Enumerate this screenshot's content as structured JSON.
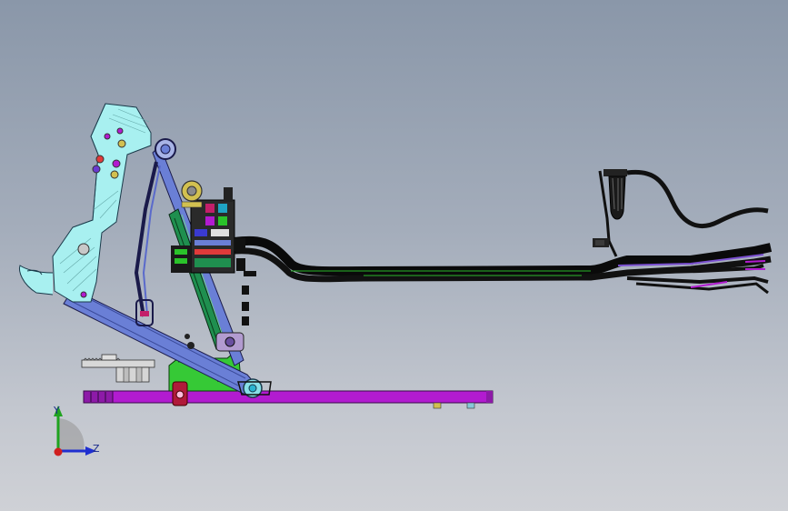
{
  "viewport": {
    "background_top": "#8a97a9",
    "background_bottom": "#cfd1d6"
  },
  "triad": {
    "y_label": "Y",
    "z_label": "Z",
    "y_color": "#1fa31f",
    "z_color": "#1f2fd0",
    "x_color": "#d01f1f"
  },
  "colors": {
    "cab": "#a8f0f0",
    "base_rail": "#b21bd0",
    "bracket": "#36c936",
    "boom": "#000000",
    "cylinder": "#1f8f4f",
    "link_arm": "#6a7fd6"
  }
}
